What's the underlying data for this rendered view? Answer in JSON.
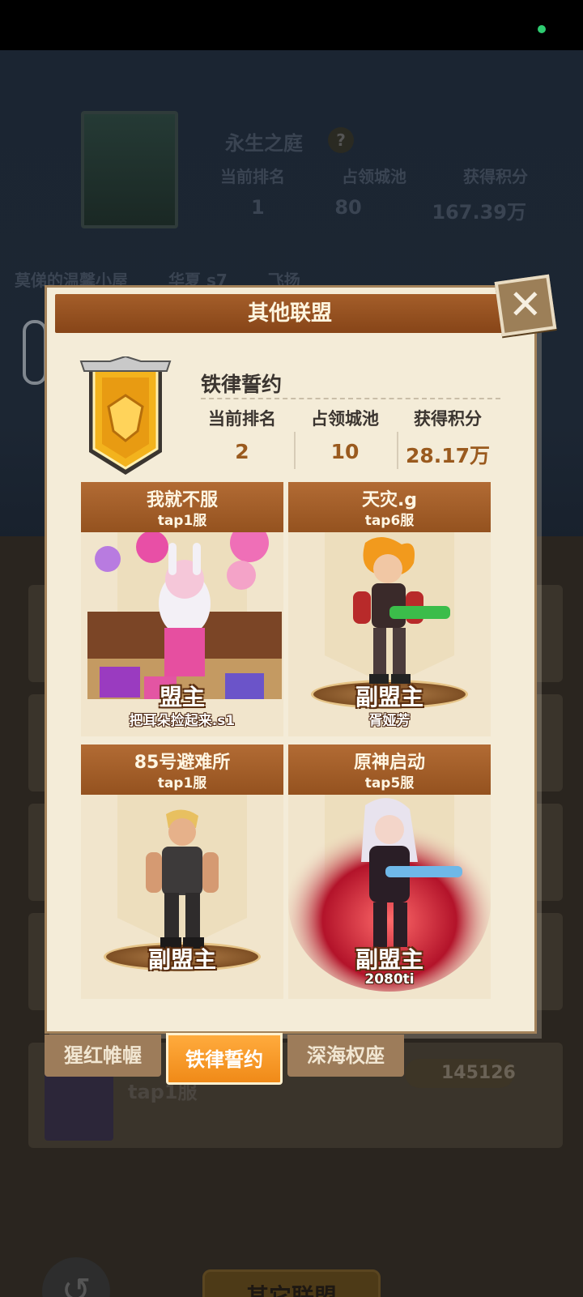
{
  "background": {
    "alliance_name": "永生之庭",
    "help": "?",
    "stat_labels": [
      "当前排名",
      "占领城池",
      "获得积分"
    ],
    "stat_values": [
      "1",
      "80",
      "167.39万"
    ],
    "row_labels": [
      "莫俤的温馨小屋",
      "华夏 s7",
      "飞扬"
    ],
    "server": "tap1服",
    "score": "145126",
    "back": "↺",
    "other_button": "其它联盟"
  },
  "modal": {
    "title": "其他联盟",
    "close": "✕",
    "alliance": {
      "name": "铁律誓约",
      "stat_labels": [
        "当前排名",
        "占领城池",
        "获得积分"
      ],
      "stat_values": [
        "2",
        "10",
        "28.17万"
      ]
    },
    "members": [
      {
        "name": "我就不服",
        "server": "tap1服",
        "role": "盟主",
        "player": "把耳朵捡起来.s1"
      },
      {
        "name": "天灾.g",
        "server": "tap6服",
        "role": "副盟主",
        "player": "胥娅芳"
      },
      {
        "name": "85号避难所",
        "server": "tap1服",
        "role": "副盟主",
        "player": ""
      },
      {
        "name": "原神启动",
        "server": "tap5服",
        "role": "副盟主",
        "player": "2080ti"
      }
    ]
  },
  "tabs": [
    "猩红帷幄",
    "铁律誓约",
    "深海权座"
  ],
  "colors": {
    "accent": "#f08a18",
    "header": "#94521f",
    "panel": "#f4ecd8"
  }
}
